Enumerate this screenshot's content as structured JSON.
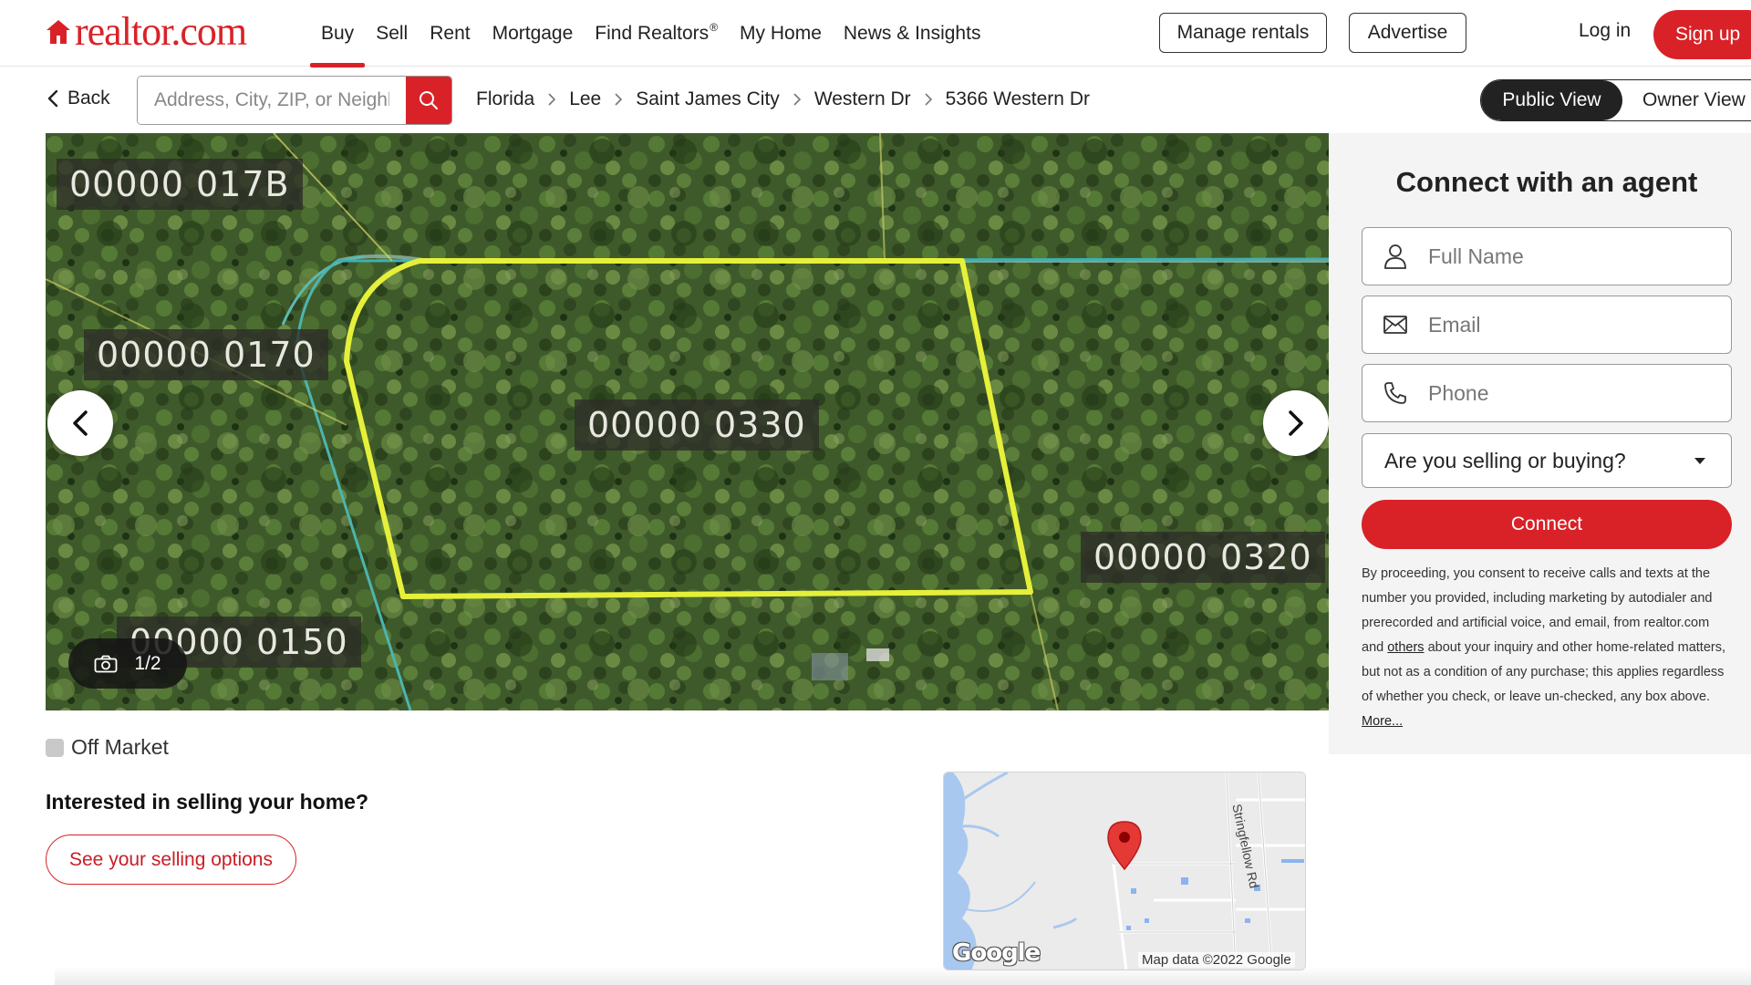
{
  "header": {
    "logo": "realtor.com",
    "nav": [
      {
        "label": "Buy",
        "active": true
      },
      {
        "label": "Sell"
      },
      {
        "label": "Rent"
      },
      {
        "label": "Mortgage"
      },
      {
        "label": "Find Realtors",
        "sup": "®"
      },
      {
        "label": "My Home"
      },
      {
        "label": "News & Insights"
      }
    ],
    "manage_rentals": "Manage rentals",
    "advertise": "Advertise",
    "login": "Log in",
    "signup": "Sign up"
  },
  "subbar": {
    "back": "Back",
    "search_placeholder": "Address, City, ZIP, or Neighborhood",
    "breadcrumb": [
      "Florida",
      "Lee",
      "Saint James City",
      "Western Dr",
      "5366 Western Dr"
    ],
    "view_public": "Public View",
    "view_owner": "Owner View"
  },
  "photo": {
    "labels": [
      "00000 017B",
      "00000 0170",
      "00000 0330",
      "00000 0320",
      "00000 0150"
    ],
    "counter": "1/2"
  },
  "agent": {
    "title": "Connect with an agent",
    "name_placeholder": "Full Name",
    "email_placeholder": "Email",
    "phone_placeholder": "Phone",
    "select_value": "Are you selling or buying?",
    "connect": "Connect",
    "consent_1": "By proceeding, you consent to receive calls and texts at the number you provided, including marketing by autodialer and prerecorded and artificial voice, and email, from realtor.com and ",
    "consent_link": "others",
    "consent_2": " about your inquiry and other home-related matters, but not as a condition of any purchase; this applies regardless of whether you check, or leave un-checked, any box above. ",
    "consent_more": "More..."
  },
  "listing": {
    "status": "Off Market",
    "sell_question": "Interested in selling your home?",
    "sell_button": "See your selling options"
  },
  "map": {
    "road": "Stringfellow Rd",
    "google": "Google",
    "data": "Map data ©2022 Google"
  },
  "colors": {
    "brand_red": "#d92228",
    "parcel_line": "#e6f03a"
  }
}
